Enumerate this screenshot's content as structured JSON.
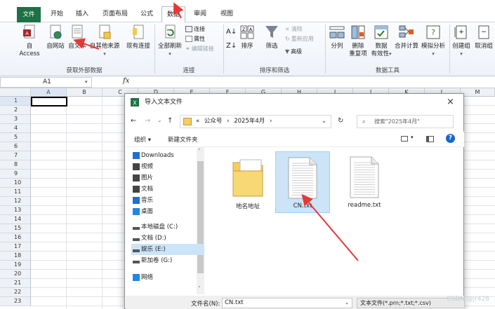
{
  "tabs": [
    {
      "label": "文件",
      "active": false,
      "file": true
    },
    {
      "label": "开始",
      "active": false
    },
    {
      "label": "插入",
      "active": false
    },
    {
      "label": "页面布局",
      "active": false
    },
    {
      "label": "公式",
      "active": false
    },
    {
      "label": "数据",
      "active": true
    },
    {
      "label": "审阅",
      "active": false
    },
    {
      "label": "视图",
      "active": false
    }
  ],
  "ribbon": {
    "external": {
      "access": "自 Access",
      "web": "自网站",
      "text": "自文本",
      "other": "自其他来源",
      "existing": "现有连接",
      "group": "获取外部数据"
    },
    "connections": {
      "refresh": "全部刷新",
      "connect": "连接",
      "properties": "属性",
      "edit_links": "编辑链接",
      "group": "连接"
    },
    "sort_filter": {
      "sort": "排序",
      "filter": "筛选",
      "clear": "清除",
      "reapply": "重新应用",
      "advanced": "高级",
      "group": "排序和筛选"
    },
    "data_tools": {
      "split": "分列",
      "remove_dup_1": "删除",
      "remove_dup_2": "重复项",
      "validation_1": "数据",
      "validation_2": "有效性",
      "consolidate": "合并计算",
      "whatif": "模拟分析",
      "group": "数据工具"
    },
    "outline": {
      "create_group": "创建组",
      "ungroup": "取消组"
    }
  },
  "formula_bar": {
    "cell": "A1",
    "fx": "fx"
  },
  "sheet": {
    "columns": [
      "A",
      "B",
      "C",
      "D",
      "E",
      "F",
      "G",
      "H",
      "I",
      "J",
      "K",
      "L",
      "M"
    ],
    "rows": [
      "1",
      "2",
      "3",
      "4",
      "5",
      "6",
      "7",
      "8",
      "9",
      "10",
      "11",
      "12",
      "13",
      "14",
      "15",
      "16",
      "17",
      "18",
      "19",
      "20",
      "21",
      "22",
      "23"
    ]
  },
  "dialog": {
    "title": "导入文本文件",
    "close": "×",
    "address": {
      "prefix": "«",
      "parts": [
        "公众号",
        "2025年4月"
      ],
      "sep": "›"
    },
    "search_placeholder": "搜索\"2025年4月\"",
    "toolbar": {
      "organize": "组织 ▾",
      "new_folder": "新建文件夹",
      "help": "?"
    },
    "nav": [
      {
        "label": "Downloads",
        "icon": "download-icon"
      },
      {
        "label": "视频",
        "icon": "video-icon"
      },
      {
        "label": "图片",
        "icon": "picture-icon"
      },
      {
        "label": "文档",
        "icon": "document-icon"
      },
      {
        "label": "音乐",
        "icon": "music-icon"
      },
      {
        "label": "桌面",
        "icon": "desktop-icon"
      },
      {
        "label": "本地磁盘 (C:)",
        "icon": "drive-icon"
      },
      {
        "label": "文档 (D:)",
        "icon": "drive-icon"
      },
      {
        "label": "娱乐 (E:)",
        "icon": "drive-icon",
        "selected": true
      },
      {
        "label": "新加卷 (G:)",
        "icon": "drive-icon"
      },
      {
        "label": "网络",
        "icon": "network-icon"
      }
    ],
    "files": [
      {
        "name": "地名地址",
        "type": "folder"
      },
      {
        "name": "CN.txt",
        "type": "text",
        "selected": true
      },
      {
        "name": "readme.txt",
        "type": "text"
      }
    ],
    "filename_label": "文件名(N):",
    "filename_value": "CN.txt",
    "filetype": "文本文件(*.prn;*.txt;*.csv)"
  },
  "watermark": "CSDN @jr428",
  "colors": {
    "excel_green": "#1e7145",
    "selection_blue": "#cce4f7",
    "arrow_red": "#e53935"
  }
}
